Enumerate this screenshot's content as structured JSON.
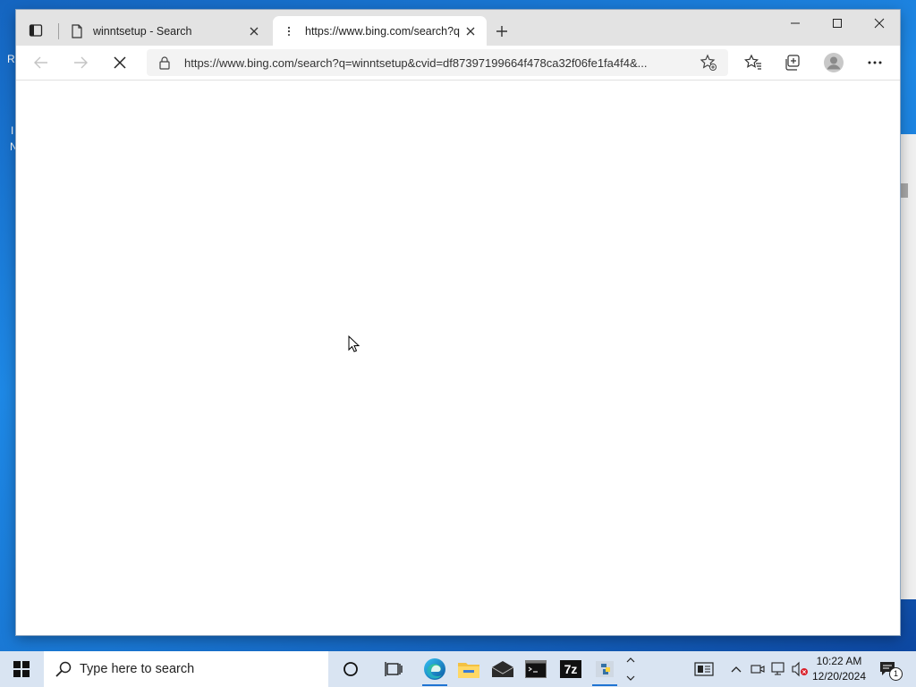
{
  "desktop": {
    "fragments": [
      "R",
      "I",
      "N"
    ]
  },
  "browser": {
    "tabs": [
      {
        "title": "winntsetup - Search",
        "active": false
      },
      {
        "title": "https://www.bing.com/search?q",
        "active": true
      }
    ],
    "address": {
      "url": "https://www.bing.com/search?q=winntsetup&cvid=df87397199664f478ca32f06fe1fa4f4&..."
    }
  },
  "taskbar": {
    "search_placeholder": "Type here to search",
    "clock": {
      "time": "10:22 AM",
      "date": "12/20/2024"
    },
    "notification_count": "1",
    "sevenzip_label": "7z"
  },
  "colors": {
    "accent": "#1e73d2",
    "taskbar": "#d9e4f2",
    "tabbar": "#e3e3e3"
  }
}
